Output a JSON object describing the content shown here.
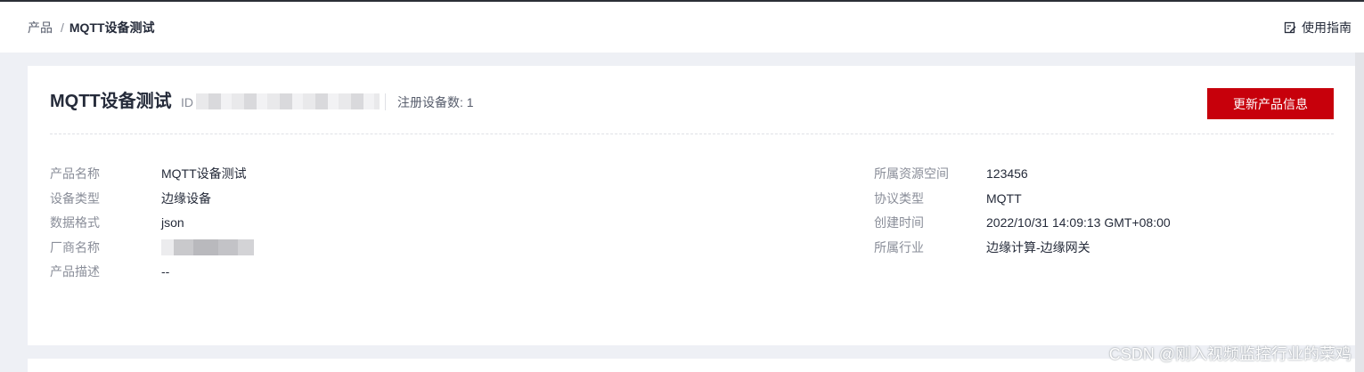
{
  "breadcrumb": {
    "root": "产品",
    "separator": "/",
    "current": "MQTT设备测试"
  },
  "header": {
    "guide_label": "使用指南",
    "guide_icon": "edit-note-icon"
  },
  "product": {
    "title": "MQTT设备测试",
    "id_label": "ID",
    "registered_devices": "注册设备数: 1",
    "update_button": "更新产品信息"
  },
  "details_left": [
    {
      "label": "产品名称",
      "value": "MQTT设备测试"
    },
    {
      "label": "设备类型",
      "value": "边缘设备"
    },
    {
      "label": "数据格式",
      "value": "json"
    },
    {
      "label": "厂商名称",
      "value": ""
    },
    {
      "label": "产品描述",
      "value": "--"
    }
  ],
  "details_right": [
    {
      "label": "所属资源空间",
      "value": "123456"
    },
    {
      "label": "协议类型",
      "value": "MQTT"
    },
    {
      "label": "创建时间",
      "value": "2022/10/31 14:09:13 GMT+08:00"
    },
    {
      "label": "所属行业",
      "value": "边缘计算-边缘网关"
    }
  ],
  "watermark": "CSDN @刚入视频监控行业的菜鸡",
  "colors": {
    "accent": "#c7000b",
    "background": "#eef0f5",
    "text_primary": "#252b3a",
    "text_secondary": "#8a8e99"
  }
}
